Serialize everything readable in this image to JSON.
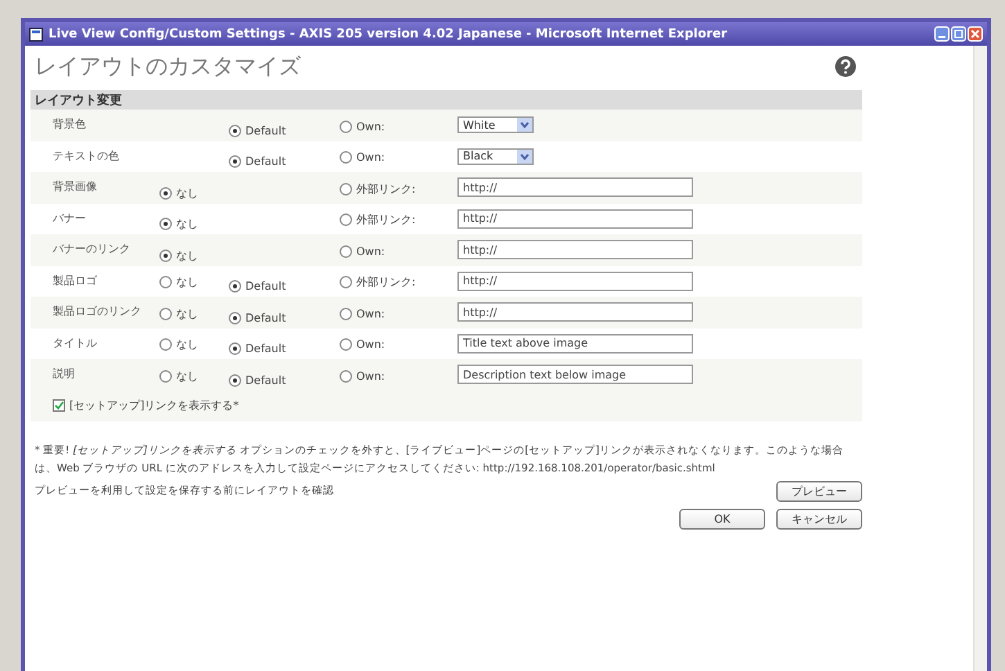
{
  "window": {
    "title": "Live View Config/Custom Settings - AXIS 205 version 4.02 Japanese - Microsoft Internet Explorer"
  },
  "heading": "レイアウトのカスタマイズ",
  "section": "レイアウト変更",
  "rows": [
    {
      "label": "背景色",
      "default": {
        "label": "Default",
        "selected": true
      },
      "own": {
        "label": "Own:",
        "selected": false
      },
      "field": {
        "kind": "select",
        "value": "White"
      }
    },
    {
      "label": "テキストの色",
      "default": {
        "label": "Default",
        "selected": true
      },
      "own": {
        "label": "Own:",
        "selected": false
      },
      "field": {
        "kind": "select",
        "value": "Black"
      }
    },
    {
      "label": "背景画像",
      "none": {
        "label": "なし",
        "selected": true
      },
      "own": {
        "label": "外部リンク:",
        "selected": false
      },
      "field": {
        "kind": "text",
        "value": "http://"
      }
    },
    {
      "label": "バナー",
      "none": {
        "label": "なし",
        "selected": true
      },
      "own": {
        "label": "外部リンク:",
        "selected": false
      },
      "field": {
        "kind": "text",
        "value": "http://"
      }
    },
    {
      "label": "バナーのリンク",
      "none": {
        "label": "なし",
        "selected": true
      },
      "own": {
        "label": "Own:",
        "selected": false
      },
      "field": {
        "kind": "text",
        "value": "http://"
      }
    },
    {
      "label": "製品ロゴ",
      "none": {
        "label": "なし",
        "selected": false
      },
      "default": {
        "label": "Default",
        "selected": true
      },
      "own": {
        "label": "外部リンク:",
        "selected": false
      },
      "field": {
        "kind": "text",
        "value": "http://"
      }
    },
    {
      "label": "製品ロゴのリンク",
      "none": {
        "label": "なし",
        "selected": false
      },
      "default": {
        "label": "Default",
        "selected": true
      },
      "own": {
        "label": "Own:",
        "selected": false
      },
      "field": {
        "kind": "text",
        "value": "http://"
      }
    },
    {
      "label": "タイトル",
      "none": {
        "label": "なし",
        "selected": false
      },
      "default": {
        "label": "Default",
        "selected": true
      },
      "own": {
        "label": "Own:",
        "selected": false
      },
      "field": {
        "kind": "text",
        "value": "Title text above image"
      }
    },
    {
      "label": "説明",
      "none": {
        "label": "なし",
        "selected": false
      },
      "default": {
        "label": "Default",
        "selected": true
      },
      "own": {
        "label": "Own:",
        "selected": false
      },
      "field": {
        "kind": "text",
        "value": "Description text below image"
      }
    }
  ],
  "setup_link": {
    "label": "[セットアップ]リンクを表示する*",
    "checked": true
  },
  "note": "* 重要! *[セットアップ]リンクを表示する* オプションのチェックを外すと、[ライブビュー]ページの[セットアップ]リンクが表示されなくなります。このような場合は、Web ブラウザの URL に次のアドレスを入力して設定ページにアクセスしてください: http://192.168.108.201/operator/basic.shtml",
  "preview_hint": "プレビューを利用して設定を保存する前にレイアウトを確認",
  "buttons": {
    "preview": "プレビュー",
    "ok": "OK",
    "cancel": "キャンセル"
  }
}
